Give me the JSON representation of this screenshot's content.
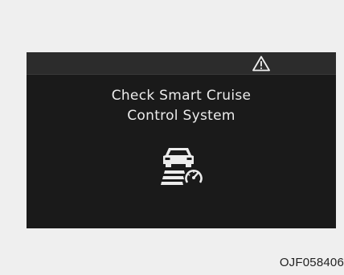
{
  "display": {
    "status_icon": "warning-triangle-icon",
    "message_line1": "Check Smart Cruise",
    "message_line2": "Control System",
    "symbol": "smart-cruise-control-icon",
    "colors": {
      "background": "#1a1a1a",
      "status_bar": "#2c2c2c",
      "text": "#ececec"
    }
  },
  "caption": {
    "code": "OJF058406"
  }
}
